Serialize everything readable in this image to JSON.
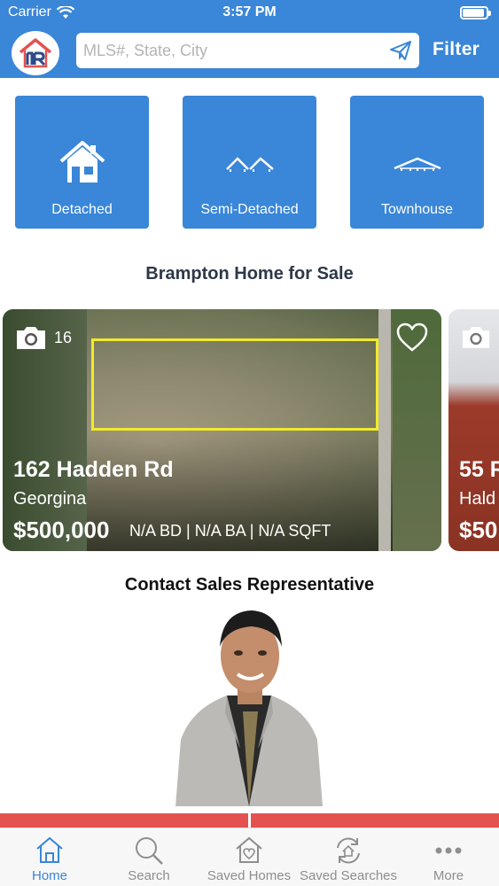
{
  "status": {
    "carrier": "Carrier",
    "time": "3:57 PM"
  },
  "header": {
    "search_placeholder": "MLS#, State, City",
    "filter_label": "Filter"
  },
  "property_types": [
    {
      "label": "Detached",
      "icon": "house-icon"
    },
    {
      "label": "Semi-Detached",
      "icon": "semi-detached-roof-icon"
    },
    {
      "label": "Townhouse",
      "icon": "townhouse-roof-icon"
    }
  ],
  "listings_section": {
    "title": "Brampton Home for Sale"
  },
  "listings": [
    {
      "photo_count": "16",
      "address": "162 Hadden Rd",
      "city": "Georgina",
      "price": "$500,000",
      "specs": "N/A BD | N/A BA | N/A SQFT"
    },
    {
      "address": "55 R",
      "city": "Hald",
      "price": "$50"
    }
  ],
  "contact_section": {
    "title": "Contact Sales Representative"
  },
  "tabs": [
    {
      "label": "Home",
      "icon": "home-icon",
      "active": true
    },
    {
      "label": "Search",
      "icon": "search-icon",
      "active": false
    },
    {
      "label": "Saved Homes",
      "icon": "saved-homes-icon",
      "active": false
    },
    {
      "label": "Saved Searches",
      "icon": "saved-searches-icon",
      "active": false
    },
    {
      "label": "More",
      "icon": "more-icon",
      "active": false
    }
  ],
  "colors": {
    "primary": "#3a86d8",
    "accent_red": "#e3524f",
    "highlight_yellow": "#f2ea2a"
  }
}
